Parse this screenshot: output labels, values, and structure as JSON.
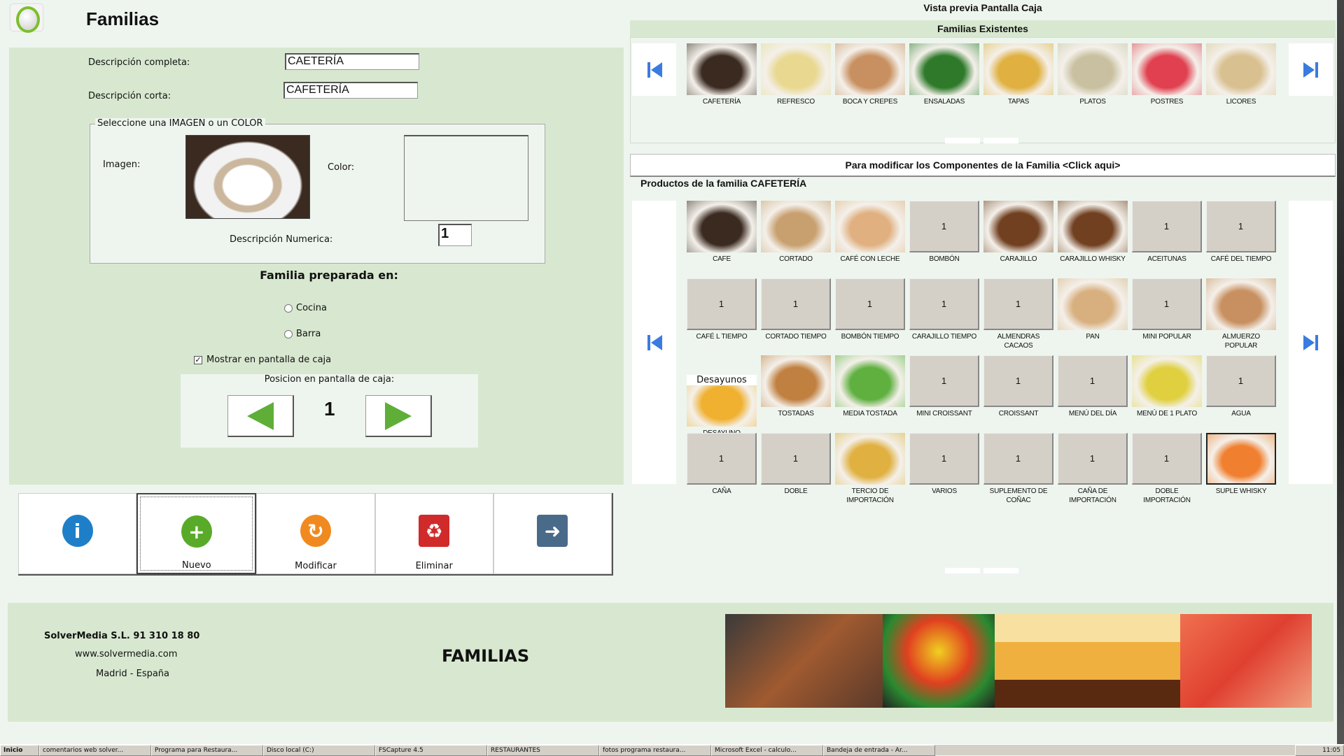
{
  "header": {
    "title": "Familias"
  },
  "form": {
    "desc_completa_label": "Descripción completa:",
    "desc_completa_value": "CAETERÍA",
    "desc_corta_label": "Descripción corta:",
    "desc_corta_value": "CAFETERÍA",
    "group_legend": "Seleccione una IMAGEN o un COLOR",
    "imagen_label": "Imagen:",
    "color_label": "Color:",
    "desc_numerica_label": "Descripción Numerica:",
    "desc_numerica_value": "1",
    "preparada_title": "Familia preparada en:",
    "radio_cocina": "Cocina",
    "radio_barra": "Barra",
    "selected_radio": "none",
    "mostrar_label": "Mostrar en pantalla de caja",
    "mostrar_checked": true,
    "posicion_label": "Posicion en pantalla de caja:",
    "posicion_value": "1"
  },
  "actions": [
    {
      "label": "",
      "icon": "info-icon",
      "color": "#1e7fc8"
    },
    {
      "label": "Nuevo",
      "icon": "plus-icon",
      "color": "#5aaa2a"
    },
    {
      "label": "Modificar",
      "icon": "refresh-icon",
      "color": "#f08a20"
    },
    {
      "label": "Eliminar",
      "icon": "trash-icon",
      "color": "#d02a2a"
    },
    {
      "label": "",
      "icon": "exit-door-icon",
      "color": "#4a6a8a"
    }
  ],
  "preview": {
    "title": "Vista previa Pantalla Caja",
    "familias_header": "Familias Existentes",
    "familias": [
      {
        "label": "CAFETERÍA",
        "tone": "#3a2a20"
      },
      {
        "label": "REFRESCO",
        "tone": "#e8d890"
      },
      {
        "label": "BOCA Y CREPES",
        "tone": "#c89060"
      },
      {
        "label": "ENSALADAS",
        "tone": "#2e7a2a"
      },
      {
        "label": "TAPAS",
        "tone": "#e0b040"
      },
      {
        "label": "PLATOS",
        "tone": "#c8c0a0"
      },
      {
        "label": "POSTRES",
        "tone": "#e04050"
      },
      {
        "label": "LICORES",
        "tone": "#d8c090"
      }
    ],
    "click_bar": "Para modificar los Componentes de la Familia <Click aqui>",
    "productos_title": "Productos de la familia CAFETERÍA",
    "productos": [
      {
        "label": "CAFE",
        "tone": "#3a2a20"
      },
      {
        "label": "CORTADO",
        "tone": "#c8a070"
      },
      {
        "label": "CAFÉ CON LECHE",
        "tone": "#e0b080"
      },
      {
        "label": "BOMBÓN",
        "num": "1"
      },
      {
        "label": "CARAJILLO",
        "tone": "#704020"
      },
      {
        "label": "CARAJILLO WHISKY",
        "tone": "#704020"
      },
      {
        "label": "ACEITUNAS",
        "num": "1"
      },
      {
        "label": "CAFÉ DEL TIEMPO",
        "num": "1"
      },
      {
        "label": "CAFÉ  L  TIEMPO",
        "num": "1"
      },
      {
        "label": "CORTADO TIEMPO",
        "num": "1"
      },
      {
        "label": "BOMBÓN TIEMPO",
        "num": "1"
      },
      {
        "label": "CARAJILLO TIEMPO",
        "num": "1"
      },
      {
        "label": "ALMENDRAS CACAOS",
        "num": "1"
      },
      {
        "label": "PAN",
        "tone": "#d8b080"
      },
      {
        "label": "MINI POPULAR",
        "num": "1"
      },
      {
        "label": "ALMUERZO POPULAR",
        "tone": "#c89060"
      },
      {
        "label": "DESAYUNO",
        "tone": "#f0b030",
        "text": "Desayunos"
      },
      {
        "label": "TOSTADAS",
        "tone": "#c08040"
      },
      {
        "label": "MEDIA TOSTADA",
        "tone": "#60b040"
      },
      {
        "label": "MINI CROISSANT",
        "num": "1"
      },
      {
        "label": "CROISSANT",
        "num": "1"
      },
      {
        "label": "MENÚ DEL DÍA",
        "num": "1"
      },
      {
        "label": "MENÚ DE 1 PLATO",
        "tone": "#e0d040"
      },
      {
        "label": "AGUA",
        "num": "1"
      },
      {
        "label": "CAÑA",
        "num": "1"
      },
      {
        "label": "DOBLE",
        "num": "1"
      },
      {
        "label": "TERCIO DE IMPORTACIÓN",
        "tone": "#e0b040"
      },
      {
        "label": "VARIOS",
        "num": "1"
      },
      {
        "label": "SUPLEMENTO DE COÑAC",
        "num": "1"
      },
      {
        "label": "CAÑA DE IMPORTACIÓN",
        "num": "1"
      },
      {
        "label": "DOBLE IMPORTACIÓN",
        "num": "1"
      },
      {
        "label": "SUPLE WHISKY",
        "tone": "#f08030",
        "selected": true
      }
    ]
  },
  "footer": {
    "company": "SolverMedia S.L. 91 310 18 80",
    "web": "www.solvermedia.com",
    "location": "Madrid - España",
    "section": "FAMILIAS"
  },
  "taskbar": {
    "start": "Inicio",
    "items": [
      "comentarios web solver...",
      "Programa para Restaura...",
      "Disco local (C:)",
      "FSCapture 4.5",
      "RESTAURANTES",
      "fotos programa restaura...",
      "Microsoft Excel - calculo...",
      "Bandeja de entrada - Ar..."
    ],
    "clock": "11:05"
  }
}
